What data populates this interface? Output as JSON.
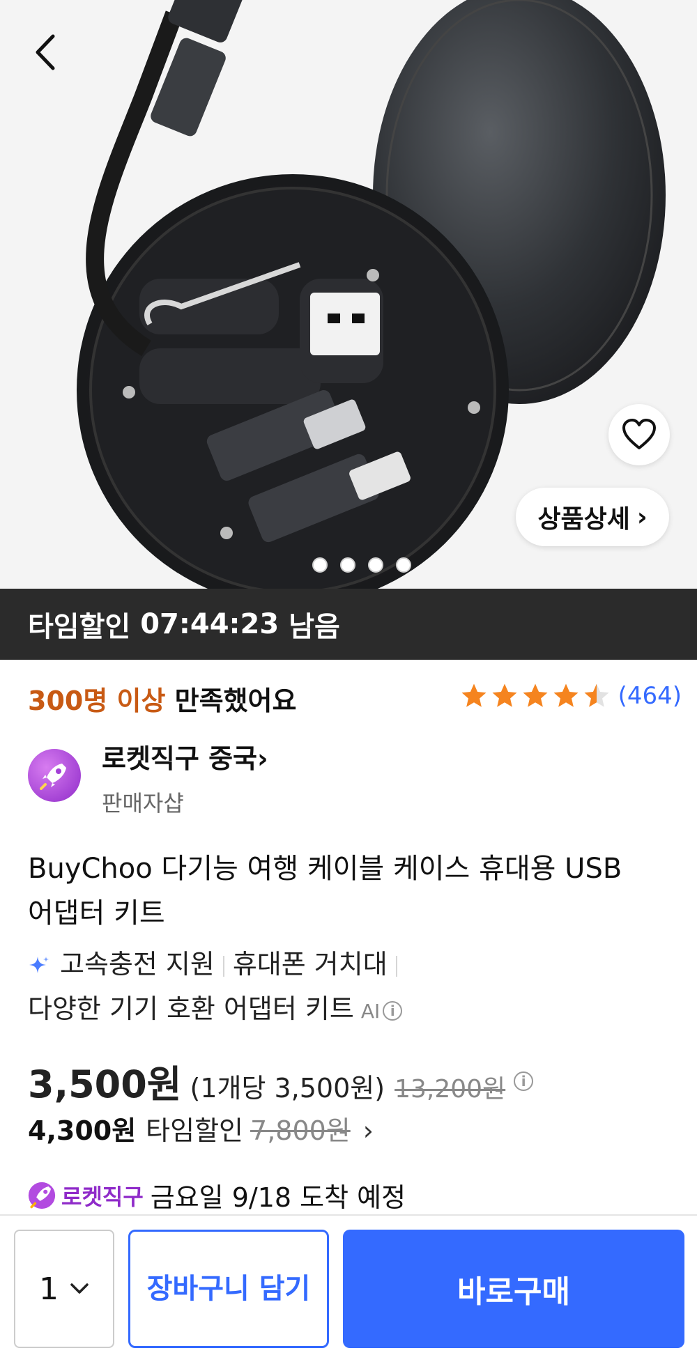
{
  "hero": {
    "detail_label": "상품상세",
    "detail_chevron": "›",
    "image_count": 4,
    "active_image": 1
  },
  "time_sale": {
    "label": "타임할인",
    "remaining": "07:44:23",
    "suffix": "남음"
  },
  "satisfaction": {
    "highlight": "300명 이상",
    "text": "만족했어요"
  },
  "rating": {
    "stars": 4.5,
    "count": "(464)",
    "color": "#f5841f"
  },
  "seller": {
    "name": "로켓직구 중국",
    "chevron": "›",
    "sub": "판매자샵"
  },
  "product": {
    "title": "BuyChoo 다기능 여행 케이블 케이스 휴대용 USB 어댑터 키트"
  },
  "features": {
    "items": [
      "고속충전 지원",
      "휴대폰 거치대",
      "다양한 기기 호환 어댑터 키트"
    ],
    "ai_label": "AI"
  },
  "price": {
    "sale": "3,500원",
    "per_unit": "(1개당 3,500원)",
    "original": "13,200원",
    "time_price": "4,300원",
    "time_label": "타임할인",
    "time_original": "7,800원",
    "time_chevron": "›"
  },
  "delivery": {
    "badge": "로켓직구",
    "text": "금요일 9/18 도착 예정"
  },
  "bottom_bar": {
    "quantity": "1",
    "cart_label": "장바구니 담기",
    "buy_label": "바로구매",
    "accent": "#346aff"
  }
}
